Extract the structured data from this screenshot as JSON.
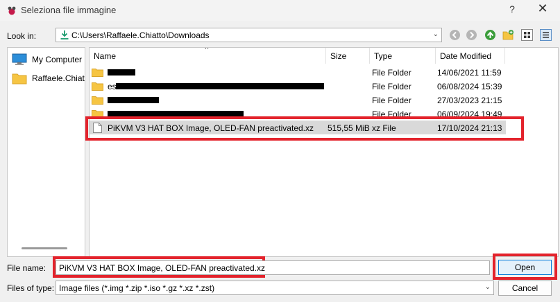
{
  "window": {
    "title": "Seleziona file immagine",
    "help": "?",
    "close": "✕"
  },
  "lookin": {
    "label": "Look in:",
    "path": "C:\\Users\\Raffaele.Chiatto\\Downloads"
  },
  "sidebar": {
    "items": [
      {
        "label": "My Computer",
        "icon": "computer-icon"
      },
      {
        "label": "Raffaele.Chiatt",
        "icon": "folder-icon"
      }
    ]
  },
  "filelist": {
    "columns": [
      "Name",
      "Size",
      "Type",
      "Date Modified"
    ],
    "rows": [
      {
        "name": "",
        "size": "",
        "type": "File Folder",
        "date": "14/06/2021 11:59",
        "redacted": true
      },
      {
        "name": "es",
        "size": "",
        "type": "File Folder",
        "date": "06/08/2024 15:39",
        "redacted": true
      },
      {
        "name": "",
        "size": "",
        "type": "File Folder",
        "date": "27/03/2023 21:15",
        "redacted": true
      },
      {
        "name": "",
        "size": "",
        "type": "File Folder",
        "date": "06/09/2024 19:49",
        "redacted": true
      },
      {
        "name": "PiKVM V3 HAT BOX Image, OLED-FAN preactivated.xz",
        "size": "515,55 MiB",
        "type": "xz File",
        "date": "17/10/2024 21:13",
        "selected": true
      }
    ]
  },
  "filename": {
    "label": "File name:",
    "value": "PiKVM V3 HAT BOX Image, OLED-FAN preactivated.xz"
  },
  "filetype": {
    "label": "Files of type:",
    "value": "Image files (*.img *.zip *.iso *.gz *.xz *.zst)"
  },
  "buttons": {
    "open": "Open",
    "cancel": "Cancel"
  },
  "colors": {
    "highlight": "#e3232c",
    "folder": "#f6c543",
    "accent": "#0078d7"
  }
}
